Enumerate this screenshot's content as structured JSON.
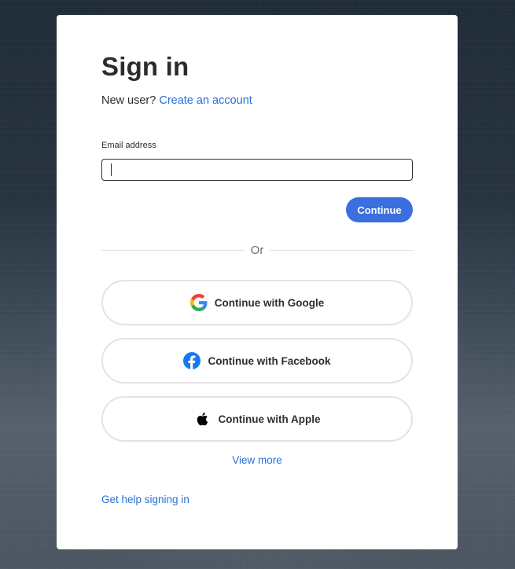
{
  "signin": {
    "title": "Sign in",
    "new_user_prefix": "New user?",
    "create_account_link": "Create an account",
    "email_label": "Email address",
    "email_value": "",
    "continue_label": "Continue",
    "divider_text": "Or",
    "social": {
      "google_label": "Continue with Google",
      "facebook_label": "Continue with Facebook",
      "apple_label": "Continue with Apple"
    },
    "view_more_link": "View more",
    "help_link": "Get help signing in"
  },
  "colors": {
    "link": "#2a6fd6",
    "primary_button": "#3b6fe0",
    "facebook": "#1877f2"
  }
}
